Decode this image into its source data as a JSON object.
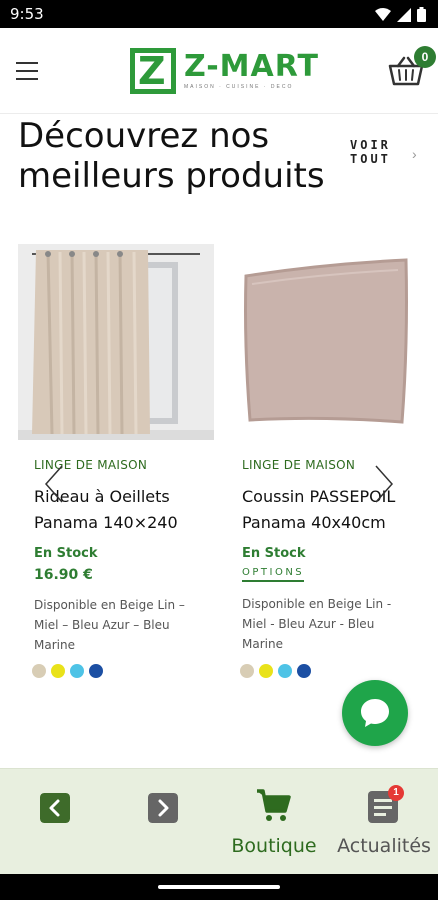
{
  "status_bar": {
    "time": "9:53"
  },
  "header": {
    "logo_name": "Z-MART",
    "logo_tagline": "MAISON · CUISINE · DECO",
    "cart_count": "0"
  },
  "section": {
    "headline": "Découvrez nos meilleurs produits",
    "voir_tout": "VOIR TOUT"
  },
  "products": [
    {
      "category": "LINGE DE MAISON",
      "title_line1": "Rideau à Oeillets",
      "title_line2": "Panama 140×240",
      "stock": "En Stock",
      "price": "16.90 €",
      "description": "Disponible en Beige Lin – Miel – Bleu Azur – Bleu Marine",
      "swatches": [
        "#d8cdb5",
        "#e9e21a",
        "#4ec3e6",
        "#1c4fa3"
      ]
    },
    {
      "category": "LINGE DE MAISON",
      "title_line1": "Coussin PASSEPOIL",
      "title_line2": "Panama 40x40cm",
      "stock": "En Stock",
      "options": "OPTIONS",
      "description": "Disponible en Beige Lin - Miel - Bleu Azur - Bleu Marine",
      "swatches": [
        "#d8cdb5",
        "#e9e21a",
        "#4ec3e6",
        "#1c4fa3"
      ]
    }
  ],
  "bottom_nav": {
    "boutique": "Boutique",
    "actualites": "Actualités",
    "actualites_badge": "1"
  },
  "colors": {
    "brand_green": "#2e9a3a",
    "text_green": "#2e7d32",
    "chat_green": "#1fa54a",
    "nav_bg": "#e8efdf"
  }
}
